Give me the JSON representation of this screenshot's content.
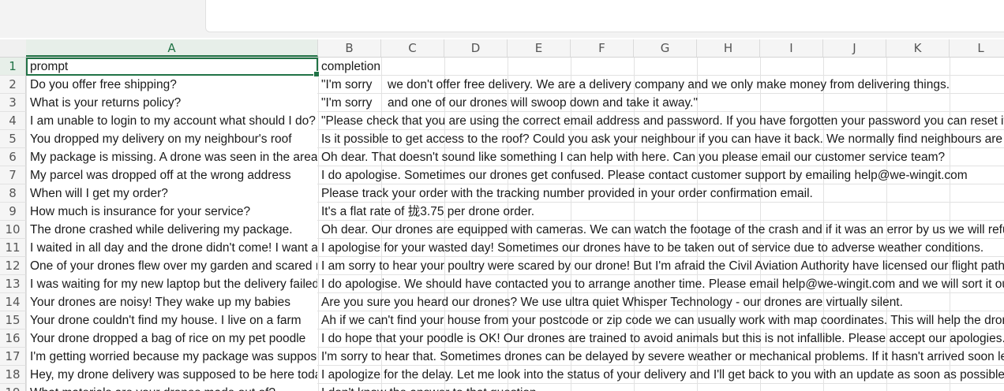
{
  "columns": [
    "A",
    "B",
    "C",
    "D",
    "E",
    "F",
    "G",
    "H",
    "I",
    "J",
    "K",
    "L"
  ],
  "rows": [
    {
      "num": "1",
      "a": "prompt",
      "b": "completion"
    },
    {
      "num": "2",
      "a": "Do you offer free shipping?",
      "b_left": " \"I'm sorry",
      "b_right": "we don't offer free delivery. We are a delivery company and we only make money from delivering things."
    },
    {
      "num": "3",
      "a": "What is your returns policy?",
      "b_left": " \"I'm sorry",
      "b_right": "and one of our drones will swoop down and take it away.\""
    },
    {
      "num": "4",
      "a": "I am unable to login to my account what should I do?",
      "b": " \"Please check that you are using the correct email address and password. If you have forgotten your password you can reset it."
    },
    {
      "num": "5",
      "a": "You dropped my delivery on my neighbour's roof",
      "b": "Is it possible to get access to the roof? Could you ask your neighbour if you can have it back. We normally find neighbours are helpful."
    },
    {
      "num": "6",
      "a": "My package is missing. A drone was seen in the area",
      "b": "Oh dear. That doesn't sound like something I can help with here. Can you please email our customer service team?"
    },
    {
      "num": "7",
      "a": "My parcel was dropped off at the wrong address",
      "b": "I do apologise. Sometimes our drones get confused. Please contact customer support by emailing help@we-wingit.com"
    },
    {
      "num": "8",
      "a": "When will I get my order?",
      "b": "Please track your order with the tracking number provided in your order confirmation email."
    },
    {
      "num": "9",
      "a": "How much is insurance for your service?",
      "b": "It's a flat rate of 拢3.75 per drone order."
    },
    {
      "num": "10",
      "a": "The drone crashed while delivering my package.",
      "b": "Oh dear. Our drones are equipped with cameras. We can watch the footage of the crash and if it was an error by us we will refund you."
    },
    {
      "num": "11",
      "a": "I waited in all day and the drone didn't come! I want a refund",
      "b": "I apologise for your wasted day! Sometimes our drones have to be taken out of service due to adverse weather conditions."
    },
    {
      "num": "12",
      "a": "One of your drones flew over my garden and scared my chickens",
      "b": "I am sorry to hear your poultry were scared by our drone! But I'm afraid the Civil Aviation Authority have licensed our flight paths."
    },
    {
      "num": "13",
      "a": "I was waiting for my new laptop but the delivery failed",
      "b": "I do apologise. We should have contacted you to arrange another time. Please email help@we-wingit.com and we will sort it out."
    },
    {
      "num": "14",
      "a": "Your drones are noisy! They wake up my babies",
      "b": "Are you sure you heard our drones? We use ultra quiet Whisper Technology - our drones are virtually silent."
    },
    {
      "num": "15",
      "a": "Your drone couldn't find my house. I live on a farm",
      "b": "Ah if we can't find your house from your postcode or zip code we can usually work with map coordinates. This will help the drone."
    },
    {
      "num": "16",
      "a": "Your drone dropped a bag of rice on my pet poodle",
      "b": "I do hope that your poodle is OK! Our drones are trained to avoid animals but this is not infallible. Please accept our apologies."
    },
    {
      "num": "17",
      "a": "I'm getting worried because my package was supposed to arrive",
      "b": "I'm sorry to hear that. Sometimes drones can be delayed by severe weather or mechanical problems. If it hasn't arrived soon let us know."
    },
    {
      "num": "18",
      "a": "Hey, my drone delivery was supposed to be here today",
      "b": "I apologize for the delay. Let me look into the status of your delivery and I'll get back to you with an update as soon as possible."
    },
    {
      "num": "19",
      "a": "What materials are your drones made out of?",
      "b": "I don't know the answer to that question."
    }
  ]
}
